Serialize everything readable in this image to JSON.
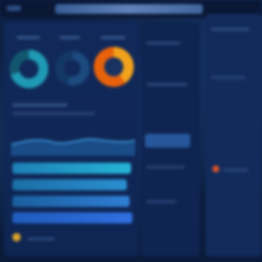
{
  "colors": {
    "background": "#0b1c3d",
    "panel": "#11295a",
    "accent_teal": "#1f9ab4",
    "accent_orange": "#e8620c",
    "accent_yellow": "#f2a21a",
    "accent_blue": "#2f7fd6",
    "bar_cyan": "#25b5d6"
  },
  "icons": {
    "menu": "menu-icon",
    "status_orange": "alert-dot-icon",
    "status_yellow": "indicator-dot-icon"
  },
  "donuts": [
    {
      "name": "donut-teal",
      "fill_fraction": 0.7
    },
    {
      "name": "donut-navy",
      "fill_fraction": 0.55
    },
    {
      "name": "donut-orange",
      "fill_fraction": 0.4
    }
  ],
  "progress": [
    {
      "name": "progress-1",
      "level": 0.92,
      "color": "#25b5d6"
    },
    {
      "name": "progress-2",
      "level": 0.88,
      "color": "#2a8fd0"
    },
    {
      "name": "progress-3",
      "level": 0.86,
      "color": "#2f7fd6"
    },
    {
      "name": "progress-4",
      "level": 0.9,
      "color": "#2f6fe0"
    }
  ]
}
